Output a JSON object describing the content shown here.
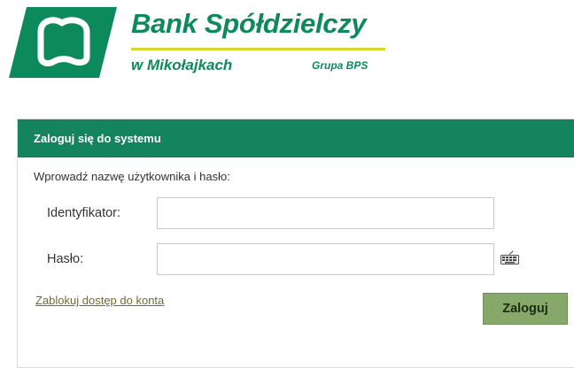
{
  "brand": {
    "name": "Bank Spółdzielczy",
    "subtitle": "w Mikołajkach",
    "group": "Grupa BPS",
    "primary_color": "#0d8a5c",
    "accent_color": "#d6d92b",
    "logo_icon": "bank-shield-logo-icon"
  },
  "login": {
    "header": "Zaloguj się do systemu",
    "header_color": "#13845d",
    "instruction": "Wprowadź nazwę użytkownika i hasło:",
    "identifier_label": "Identyfikator:",
    "identifier_value": "",
    "password_label": "Hasło:",
    "password_value": "",
    "keyboard_icon": "virtual-keyboard-icon",
    "block_link": "Zablokuj dostęp do konta",
    "submit_label": "Zaloguj",
    "submit_color": "#86a96a"
  }
}
